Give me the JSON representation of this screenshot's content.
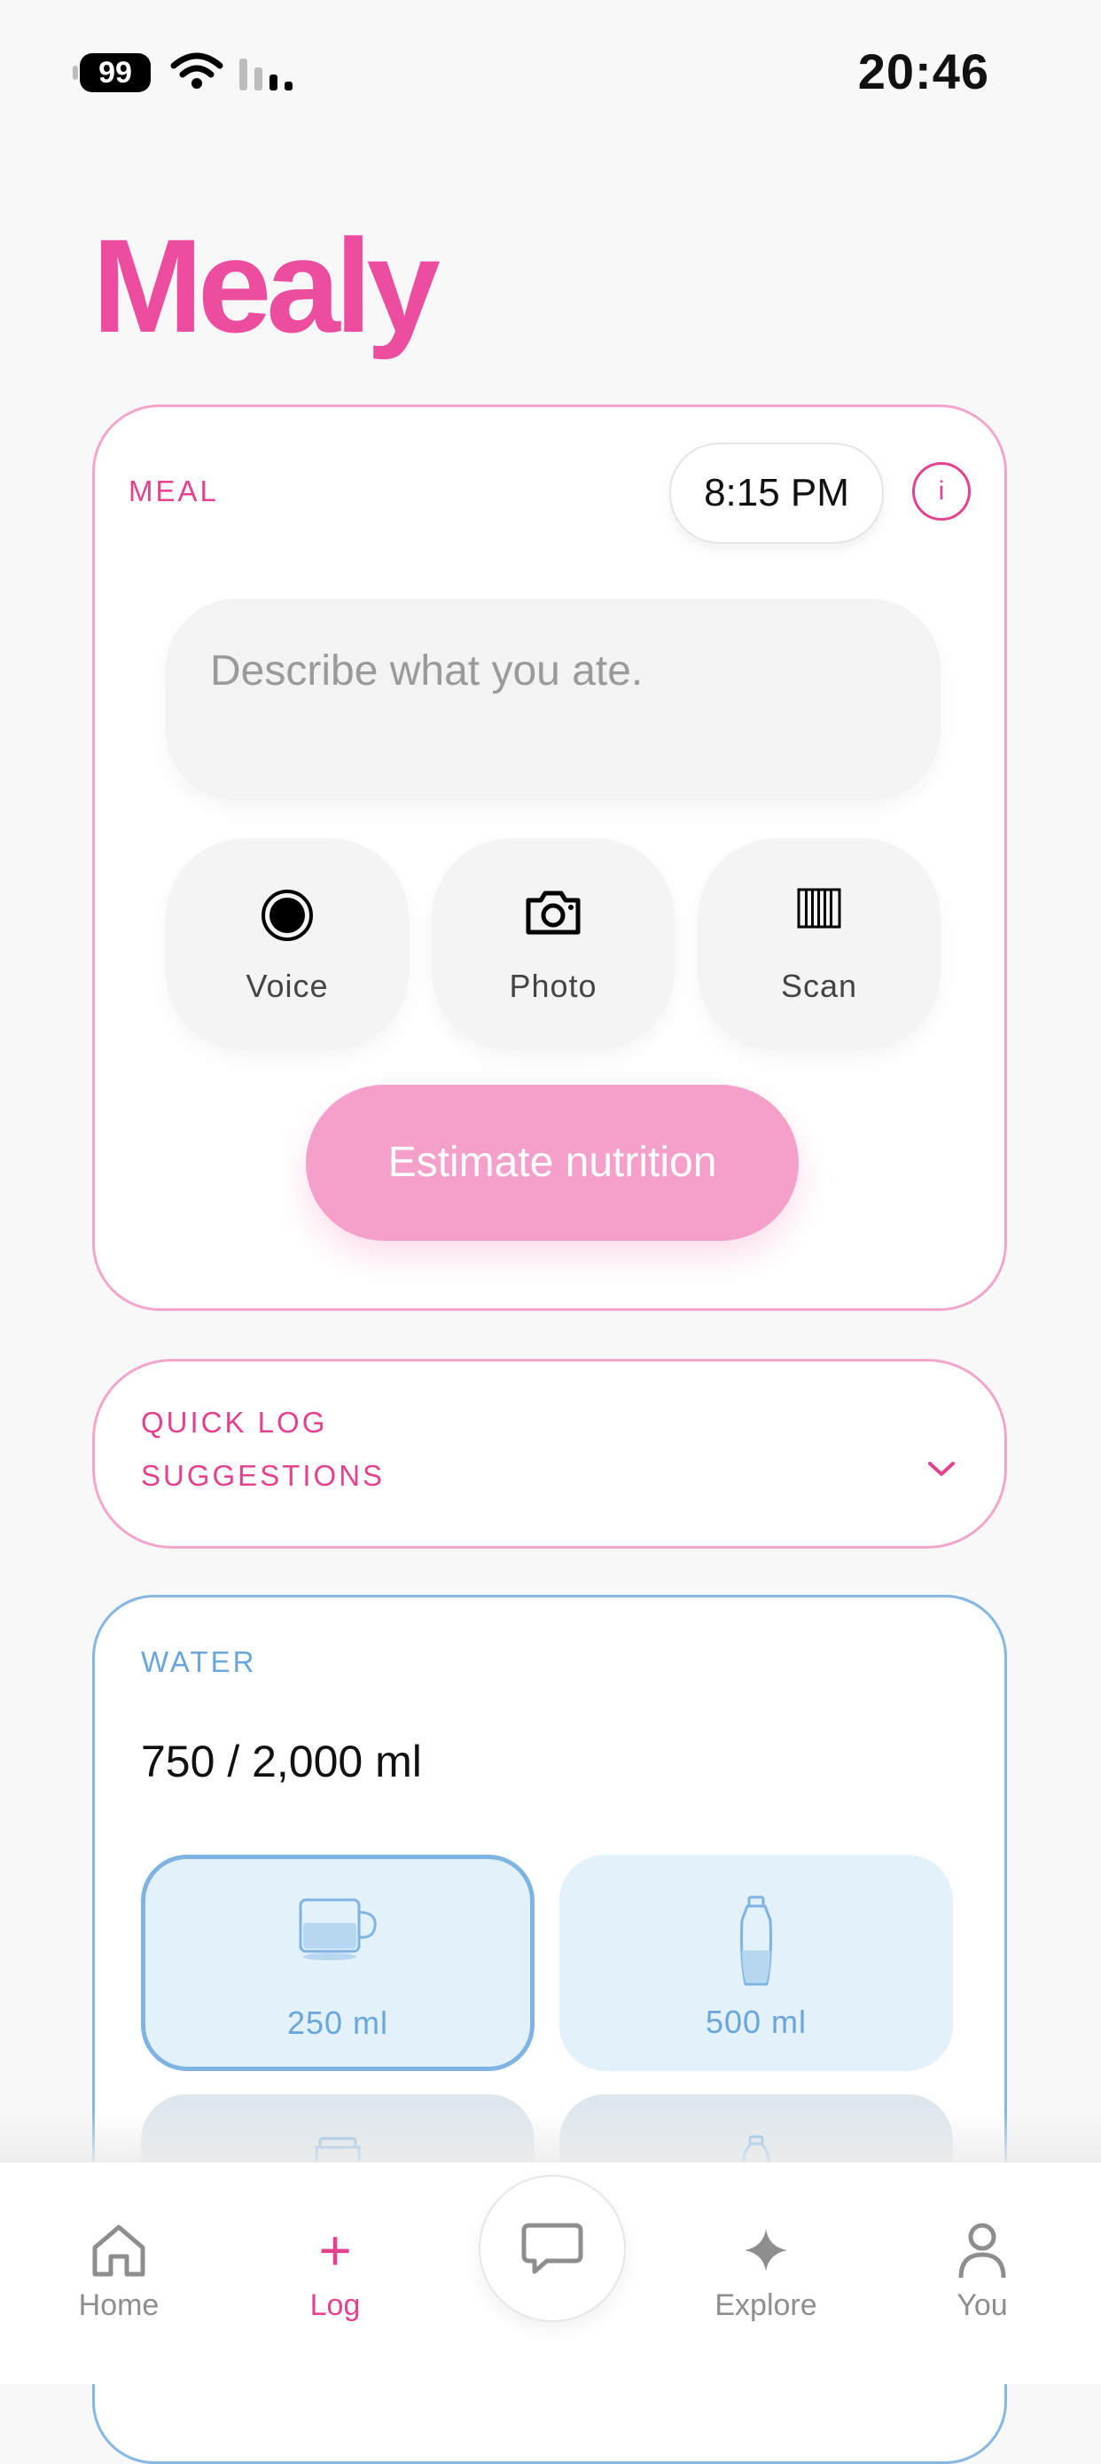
{
  "status_bar": {
    "battery": "99",
    "time": "20:46"
  },
  "app": {
    "logo": "Mealy"
  },
  "meal": {
    "label": "MEAL",
    "time": "8:15 PM",
    "info_icon": "i",
    "description_placeholder": "Describe what you ate.",
    "actions": [
      {
        "label": "Voice",
        "icon": "record-icon"
      },
      {
        "label": "Photo",
        "icon": "camera-icon"
      },
      {
        "label": "Scan",
        "icon": "barcode-icon"
      }
    ],
    "estimate_label": "Estimate nutrition"
  },
  "quick_log": {
    "line1": "QUICK LOG",
    "line2": "SUGGESTIONS"
  },
  "water": {
    "label": "WATER",
    "amount": "750 / 2,000 ml",
    "options": [
      {
        "label": "250 ml",
        "icon": "cup-icon",
        "selected": true
      },
      {
        "label": "500 ml",
        "icon": "bottle-icon",
        "selected": false
      }
    ]
  },
  "nav": {
    "items": [
      {
        "label": "Home",
        "icon": "home-icon"
      },
      {
        "label": "Log",
        "icon": "plus-icon",
        "active": true
      },
      {
        "label": "",
        "icon": "chat-icon"
      },
      {
        "label": "Explore",
        "icon": "sparkle-icon"
      },
      {
        "label": "You",
        "icon": "person-icon"
      }
    ]
  },
  "colors": {
    "brand_pink": "#ec4d9f",
    "pink_border": "#f2a6cb",
    "water_blue": "#6aa6da",
    "estimate_button": "#f5a0cb"
  }
}
